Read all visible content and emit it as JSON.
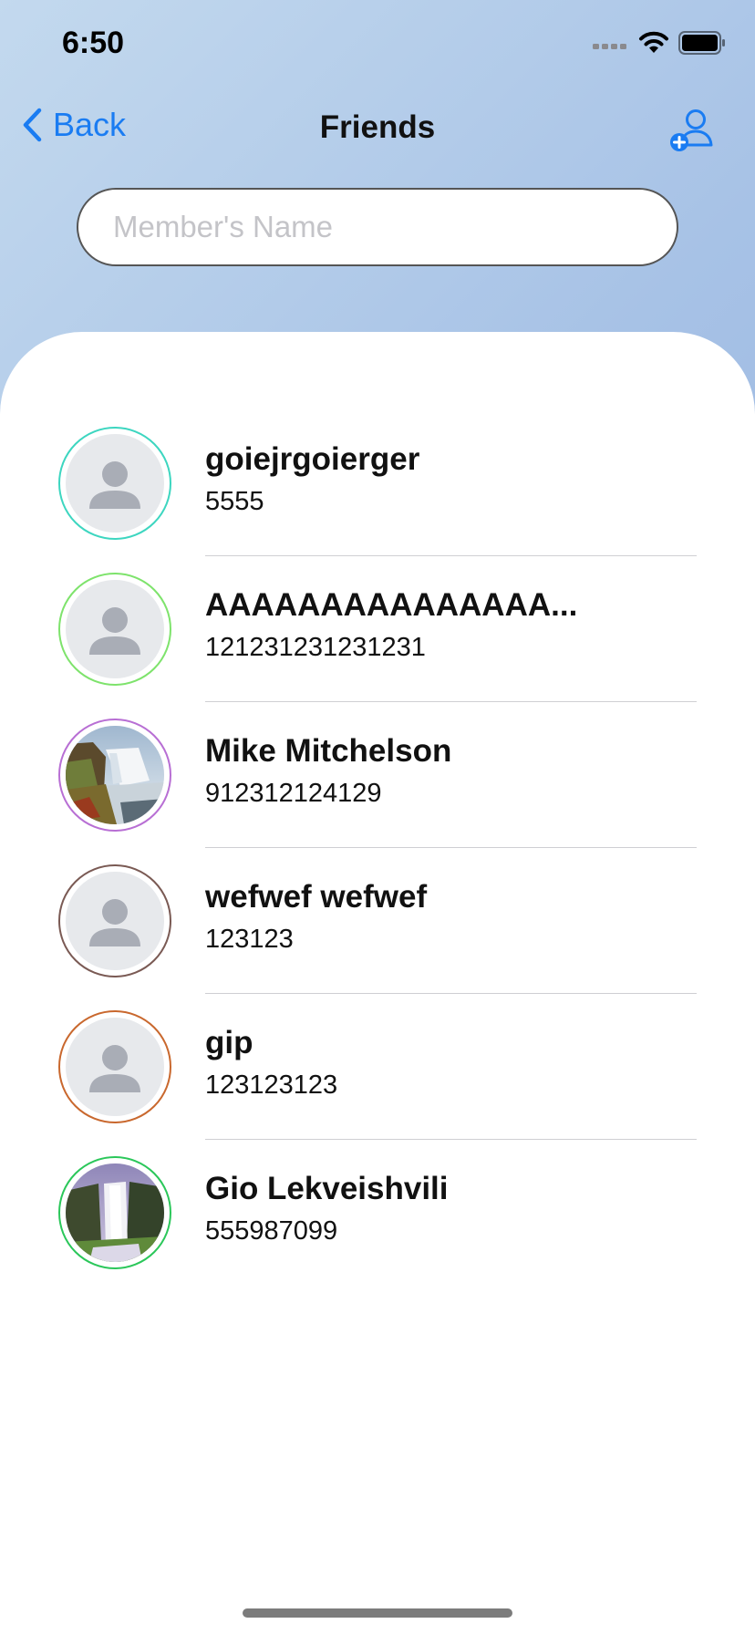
{
  "status_bar": {
    "time": "6:50"
  },
  "nav": {
    "back_label": "Back",
    "title": "Friends",
    "add_icon": "add-person-icon"
  },
  "search": {
    "placeholder": "Member's Name",
    "value": ""
  },
  "friends": [
    {
      "name": "goiejrgoierger",
      "phone": "5555",
      "ring_color": "#3dd6c0",
      "avatar": "placeholder"
    },
    {
      "name": "AAAAAAAAAAAAAAA...",
      "phone": "121231231231231",
      "ring_color": "#7ee36c",
      "avatar": "placeholder"
    },
    {
      "name": "Mike Mitchelson",
      "phone": "912312124129",
      "ring_color": "#b86fd4",
      "avatar": "photo-waterfall-wide"
    },
    {
      "name": "wefwef wefwef",
      "phone": "123123",
      "ring_color": "#7a5a54",
      "avatar": "placeholder"
    },
    {
      "name": "gip",
      "phone": "123123123",
      "ring_color": "#c9682e",
      "avatar": "placeholder"
    },
    {
      "name": "Gio Lekveishvili",
      "phone": "555987099",
      "ring_color": "#2bc75a",
      "avatar": "photo-waterfall-tall"
    }
  ],
  "colors": {
    "accent": "#1a7cf2",
    "text": "#111111",
    "placeholder": "#c4c4c8"
  }
}
